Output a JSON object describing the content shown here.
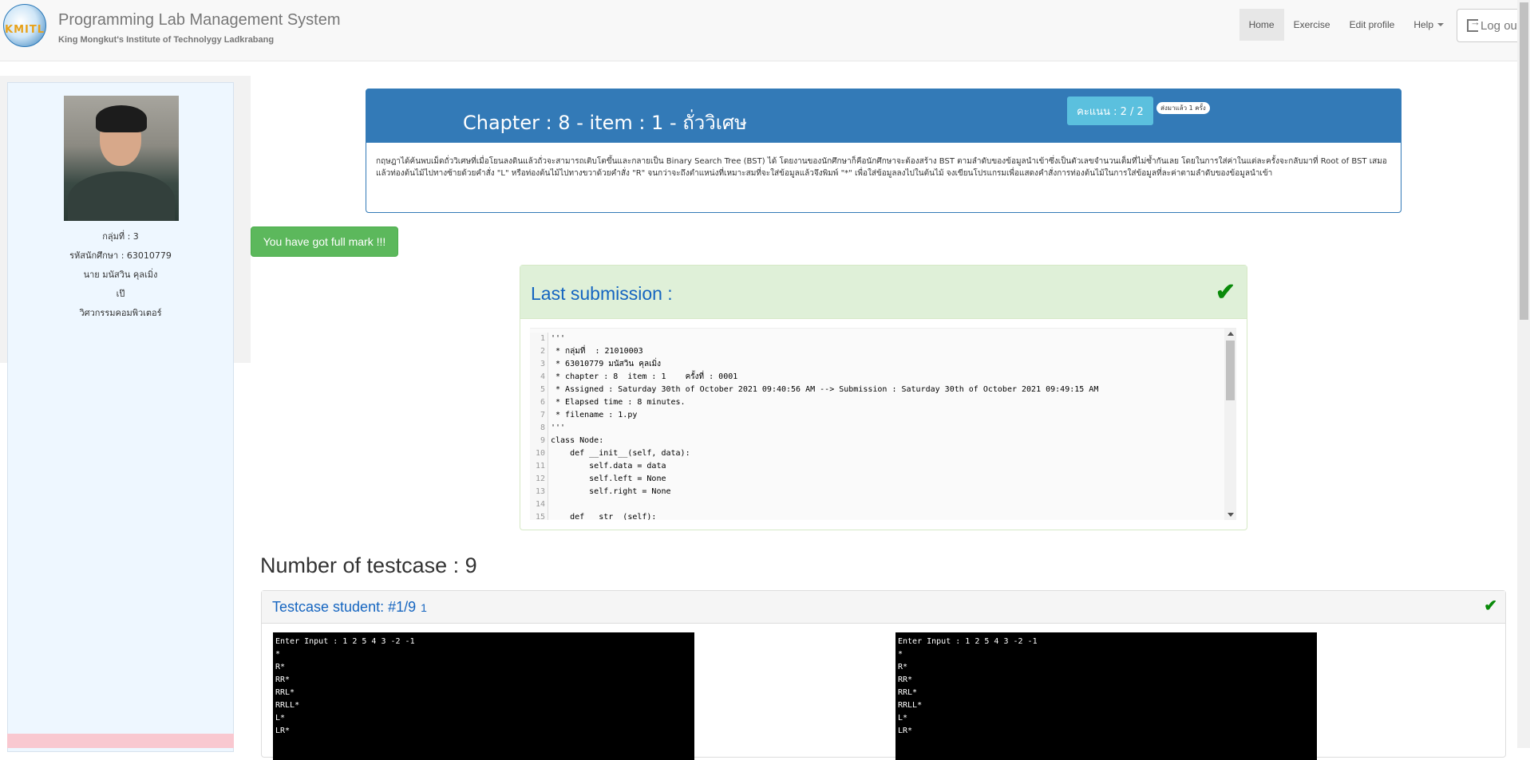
{
  "app": {
    "title": "Programming Lab Management System",
    "subtitle": "King Mongkut's Institute of Technolygy Ladkrabang",
    "logo_text": "KMITL"
  },
  "nav": {
    "home": "Home",
    "exercise": "Exercise",
    "edit_profile": "Edit profile",
    "help": "Help",
    "logout": "Log out"
  },
  "profile": {
    "group": "กลุ่มที่ : 3",
    "student_id": "รหัสนักศึกษา : 63010779",
    "name": "นาย มนัสวิน คุลเมิ่ง",
    "nickname": "เป๊",
    "department": "วิศวกรรมคอมพิวเตอร์"
  },
  "exercise": {
    "title": "Chapter : 8 - item : 1 - ถั่ววิเศษ",
    "score": "คะแนน : 2 / 2",
    "sent_badge": "ส่งมาแล้ว 1 ครั้ง",
    "description": "กฤษฎาได้ค้นพบเม็ดถั่ววิเศษที่เมื่อโยนลงดินแล้วถั่วจะสามารถเติบโตขึ้นและกลายเป็น Binary Search Tree (BST) ได้ โดยงานของนักศึกษาก็คือนักศึกษาจะต้องสร้าง BST ตามลำดับของข้อมูลนำเข้าซึ่งเป็นตัวเลขจำนวนเต็มที่ไม่ซ้ำกันเลย โดยในการใส่ค่าในแต่ละครั้งจะกลับมาที่ Root of BST เสมอ  แล้วท่องต้นไม้ไปทางซ้ายด้วยคำสั่ง \"L\" หรือท่องต้นไม้ไปทางขวาด้วยคำสั่ง \"R\" จนกว่าจะถึงตำแหน่งที่เหมาะสมที่จะใส่ข้อมูลแล้วจึงพิมพ์ \"*\" เพื่อใส่ข้อมูลลงไปในต้นไม้  จงเขียนโปรแกรมเพื่อแสดงคำสั่งการท่องต้นไม้ในการใส่ข้อมูลที่ละค่าตามลำดับของข้อมูลนำเข้า"
  },
  "full_mark": "You have got full mark !!!",
  "submission": {
    "title": "Last submission :",
    "lines": [
      {
        "n": "1",
        "t": "'''"
      },
      {
        "n": "2",
        "t": " * กลุ่มที่  : 21010003"
      },
      {
        "n": "3",
        "t": " * 63010779 มนัสวิน คุลเมิ่ง"
      },
      {
        "n": "4",
        "t": " * chapter : 8  item : 1    ครั้งที่ : 0001"
      },
      {
        "n": "5",
        "t": " * Assigned : Saturday 30th of October 2021 09:40:56 AM --> Submission : Saturday 30th of October 2021 09:49:15 AM"
      },
      {
        "n": "6",
        "t": " * Elapsed time : 8 minutes."
      },
      {
        "n": "7",
        "t": " * filename : 1.py"
      },
      {
        "n": "8",
        "t": "'''"
      },
      {
        "n": "9",
        "t": "class Node:"
      },
      {
        "n": "10",
        "t": "    def __init__(self, data):"
      },
      {
        "n": "11",
        "t": "        self.data = data"
      },
      {
        "n": "12",
        "t": "        self.left = None"
      },
      {
        "n": "13",
        "t": "        self.right = None"
      },
      {
        "n": "14",
        "t": ""
      },
      {
        "n": "15",
        "t": "    def __str__(self):"
      }
    ]
  },
  "testcases": {
    "heading": "Number of testcase : 9",
    "title": "Testcase student: #1/9",
    "number": "1",
    "student_output": [
      "Enter Input : 1 2 5 4 3 -2 -1",
      "*",
      "R*",
      "RR*",
      "RRL*",
      "RRLL*",
      "L*",
      "LR*"
    ],
    "expected_output": [
      "Enter Input : 1 2 5 4 3 -2 -1",
      "*",
      "R*",
      "RR*",
      "RRL*",
      "RRLL*",
      "L*",
      "LR*"
    ]
  },
  "icons": {
    "check": "✔",
    "logout": "logout-icon"
  },
  "colors": {
    "primary": "#337ab7",
    "success": "#5cb85c",
    "info": "#5bc0de",
    "link": "#1565c0"
  }
}
